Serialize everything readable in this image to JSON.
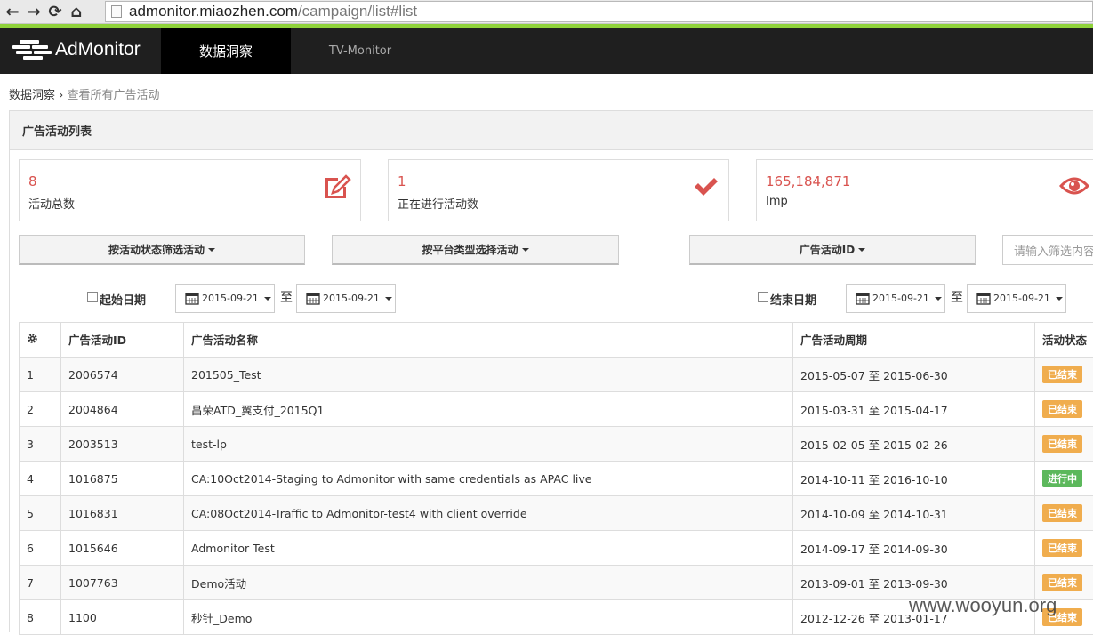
{
  "browser": {
    "url_host": "admonitor.miaozhen.com",
    "url_path": "/campaign/list#list"
  },
  "nav": {
    "logo": "AdMonitor",
    "tab_active": "数据洞察",
    "tab_tv": "TV-Monitor"
  },
  "breadcrumb": {
    "root": "数据洞察",
    "sep": "›",
    "current": "查看所有广告活动"
  },
  "panel": {
    "title": "广告活动列表"
  },
  "stats": [
    {
      "value": "8",
      "label": "活动总数",
      "icon": "edit-icon"
    },
    {
      "value": "1",
      "label": "正在进行活动数",
      "icon": "check-icon"
    },
    {
      "value": "165,184,871",
      "label": "Imp",
      "icon": "eye-icon"
    }
  ],
  "filters": {
    "by_status": "按活动状态筛选活动",
    "by_platform": "按平台类型选择活动",
    "by_id": "广告活动ID",
    "search_placeholder": "请输入筛选内容"
  },
  "dates": {
    "start_label": "起始日期",
    "end_label": "结束日期",
    "to": "至",
    "start_from": "2015-09-21",
    "start_to": "2015-09-21",
    "end_from": "2015-09-21",
    "end_to": "2015-09-21"
  },
  "table": {
    "headers": [
      "广告活动ID",
      "广告活动名称",
      "广告活动周期",
      "活动状态"
    ],
    "rows": [
      {
        "n": "1",
        "id": "2006574",
        "name": "201505_Test",
        "period": "2015-05-07 至 2015-06-30",
        "status": "已结束"
      },
      {
        "n": "2",
        "id": "2004864",
        "name": "昌荣ATD_翼支付_2015Q1",
        "period": "2015-03-31 至 2015-04-17",
        "status": "已结束"
      },
      {
        "n": "3",
        "id": "2003513",
        "name": "test-lp",
        "period": "2015-02-05 至 2015-02-26",
        "status": "已结束"
      },
      {
        "n": "4",
        "id": "1016875",
        "name": "CA:10Oct2014-Staging to Admonitor with same credentials as APAC live",
        "period": "2014-10-11 至 2016-10-10",
        "status": "进行中"
      },
      {
        "n": "5",
        "id": "1016831",
        "name": "CA:08Oct2014-Traffic to Admonitor-test4 with client override",
        "period": "2014-10-09 至 2014-10-31",
        "status": "已结束"
      },
      {
        "n": "6",
        "id": "1015646",
        "name": "Admonitor Test",
        "period": "2014-09-17 至 2014-09-30",
        "status": "已结束"
      },
      {
        "n": "7",
        "id": "1007763",
        "name": "Demo活动",
        "period": "2013-09-01 至 2013-09-30",
        "status": "已结束"
      },
      {
        "n": "8",
        "id": "1100",
        "name": "秒针_Demo",
        "period": "2012-12-26 至 2013-01-17",
        "status": "已结束"
      }
    ]
  },
  "watermark": "www.wooyun.org",
  "colors": {
    "accent_red": "#d9534f",
    "badge_ended": "#f0ad4e",
    "badge_running": "#5cb85c",
    "nav_bg": "#1f1f1f"
  }
}
